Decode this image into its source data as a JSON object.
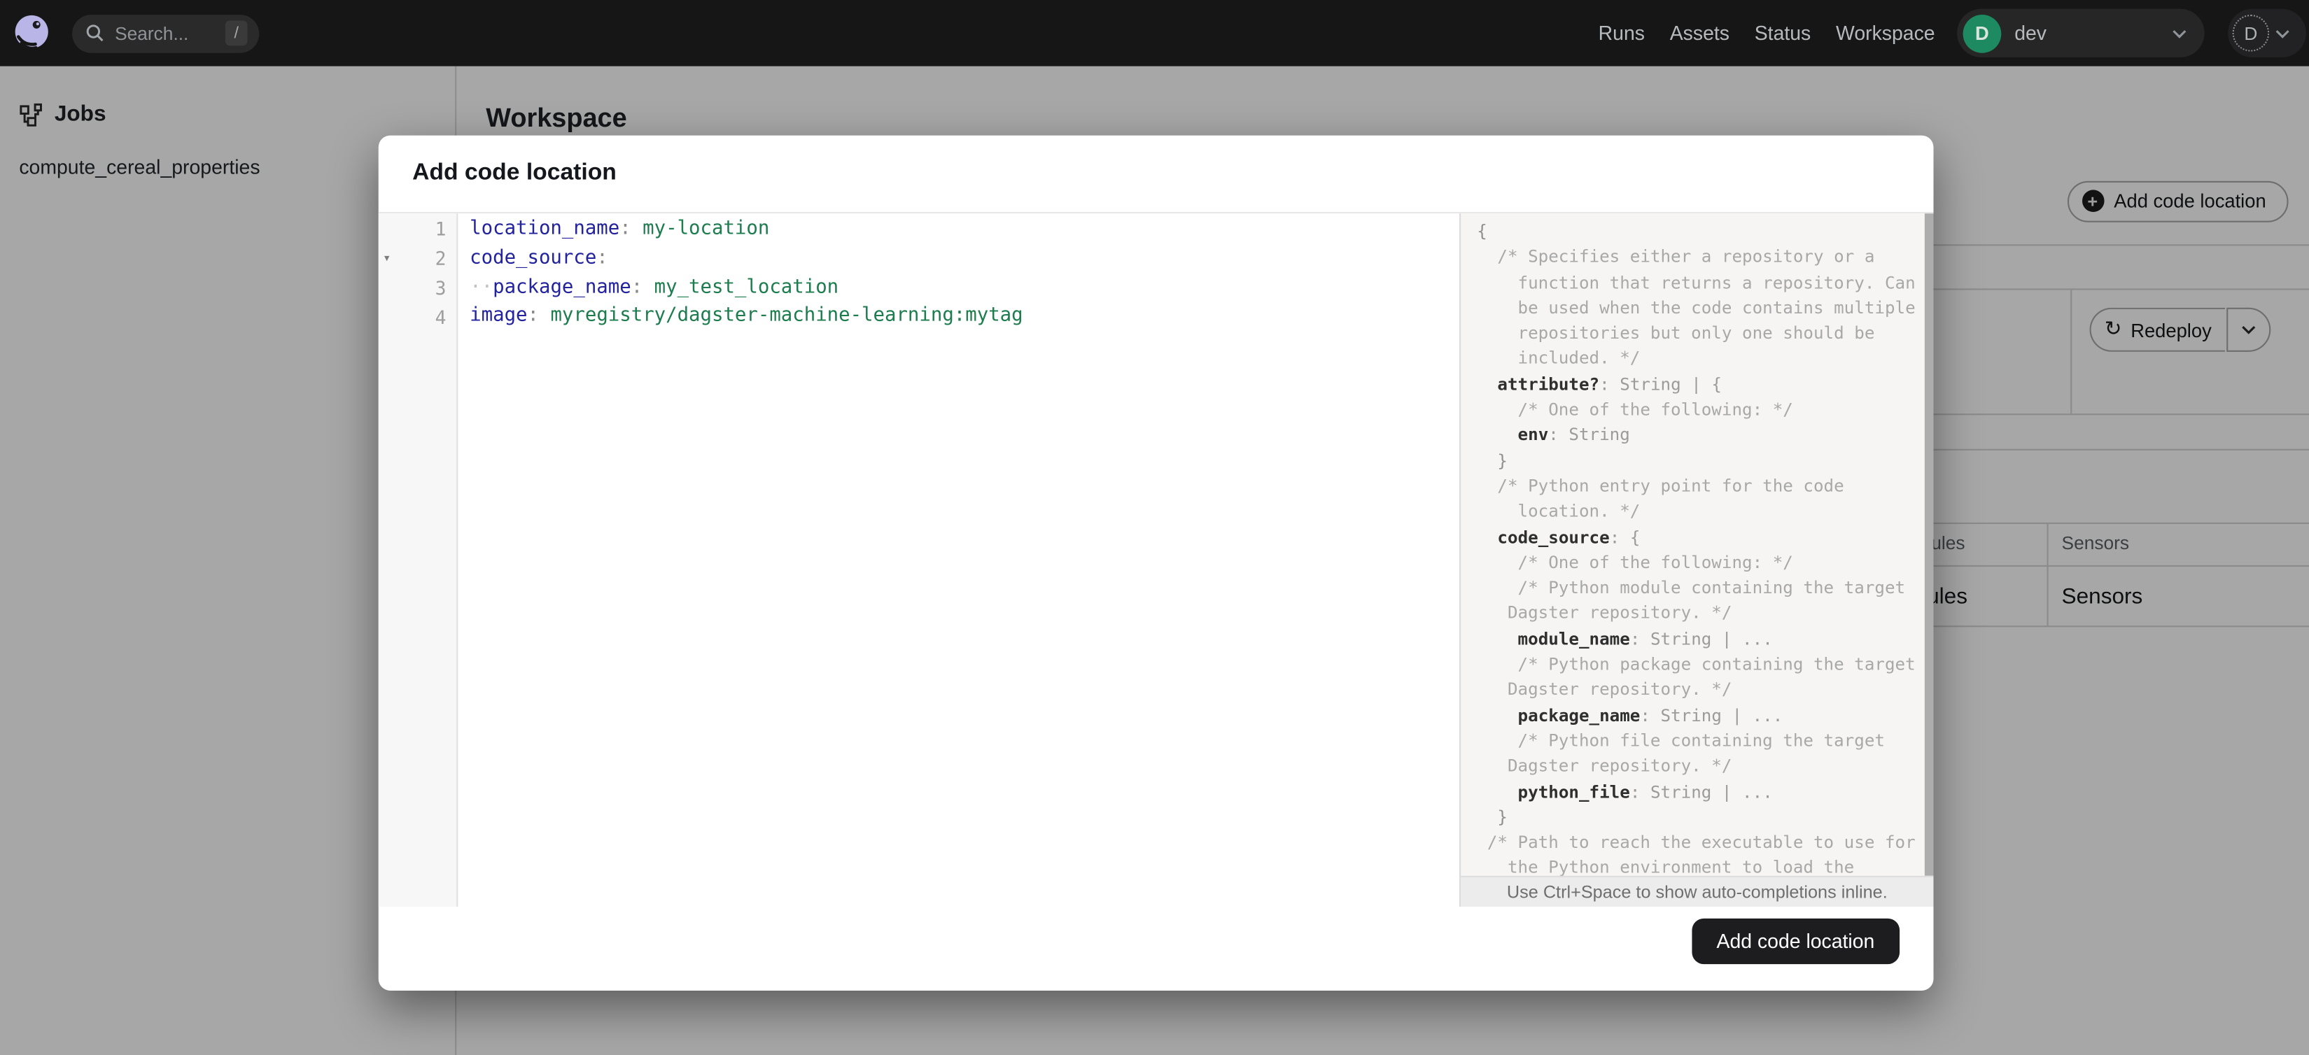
{
  "nav": {
    "search": {
      "placeholder": "Search...",
      "shortcut": "/"
    },
    "links": [
      "Runs",
      "Assets",
      "Status",
      "Workspace"
    ],
    "deployment": {
      "badge_initial": "D",
      "name": "dev"
    },
    "user": {
      "initial": "D"
    }
  },
  "sidebar": {
    "section_title": "Jobs",
    "items": [
      "compute_cereal_properties"
    ]
  },
  "page": {
    "title": "Workspace",
    "add_code_location_label": "Add code location",
    "redeploy_label": "Redeploy",
    "table": {
      "headers": [
        "Schedules",
        "Sensors"
      ],
      "row": [
        "Schedules",
        "Sensors"
      ]
    }
  },
  "modal": {
    "title": "Add code location",
    "submit_label": "Add code location",
    "hint": "Use Ctrl+Space to show auto-completions inline.",
    "editor_lines": [
      {
        "num": "1",
        "fold": "",
        "segs": [
          [
            "k",
            "location_name"
          ],
          [
            "c",
            ": "
          ],
          [
            "v",
            "my-location"
          ]
        ]
      },
      {
        "num": "2",
        "fold": "▾",
        "segs": [
          [
            "k",
            "code_source"
          ],
          [
            "c",
            ":"
          ]
        ]
      },
      {
        "num": "3",
        "fold": "",
        "segs": [
          [
            "w",
            "··"
          ],
          [
            "k",
            "package_name"
          ],
          [
            "c",
            ": "
          ],
          [
            "v",
            "my_test_location"
          ]
        ]
      },
      {
        "num": "4",
        "fold": "",
        "segs": [
          [
            "k",
            "image"
          ],
          [
            "c",
            ": "
          ],
          [
            "v",
            "myregistry/dagster-machine-learning:mytag"
          ]
        ]
      }
    ],
    "schema_lines": [
      {
        "t": "p",
        "s": "{"
      },
      {
        "t": "cm",
        "s": "  /* Specifies either a repository or a"
      },
      {
        "t": "cm",
        "s": "    function that returns a repository. Can"
      },
      {
        "t": "cm",
        "s": "    be used when the code contains multiple"
      },
      {
        "t": "cm",
        "s": "    repositories but only one should be"
      },
      {
        "t": "cm",
        "s": "    included. */"
      },
      {
        "t": "key",
        "i": "  ",
        "k": "attribute?",
        "r": ": String | {"
      },
      {
        "t": "cm",
        "s": "    /* One of the following: */"
      },
      {
        "t": "key",
        "i": "    ",
        "k": "env",
        "r": ": String"
      },
      {
        "t": "p",
        "s": "  }"
      },
      {
        "t": "cm",
        "s": "  /* Python entry point for the code"
      },
      {
        "t": "cm",
        "s": "    location. */"
      },
      {
        "t": "key",
        "i": "  ",
        "k": "code_source",
        "r": ": {"
      },
      {
        "t": "cm",
        "s": "    /* One of the following: */"
      },
      {
        "t": "cm",
        "s": "    /* Python module containing the target"
      },
      {
        "t": "cm",
        "s": "   Dagster repository. */"
      },
      {
        "t": "key",
        "i": "    ",
        "k": "module_name",
        "r": ": String | ..."
      },
      {
        "t": "cm",
        "s": "    /* Python package containing the target"
      },
      {
        "t": "cm",
        "s": "   Dagster repository. */"
      },
      {
        "t": "key",
        "i": "    ",
        "k": "package_name",
        "r": ": String | ..."
      },
      {
        "t": "cm",
        "s": "    /* Python file containing the target"
      },
      {
        "t": "cm",
        "s": "   Dagster repository. */"
      },
      {
        "t": "key",
        "i": "    ",
        "k": "python_file",
        "r": ": String | ..."
      },
      {
        "t": "p",
        "s": "  }"
      },
      {
        "t": "cm",
        "s": " /* Path to reach the executable to use for"
      },
      {
        "t": "cm",
        "s": "   the Python environment to load the"
      }
    ]
  },
  "colors": {
    "deployment_badge_green": "#1d8a62",
    "editor_key": "#23249d",
    "editor_value": "#1d7d4f",
    "submit_button_bg": "#1d1d1f",
    "nav_bg": "#161616"
  }
}
